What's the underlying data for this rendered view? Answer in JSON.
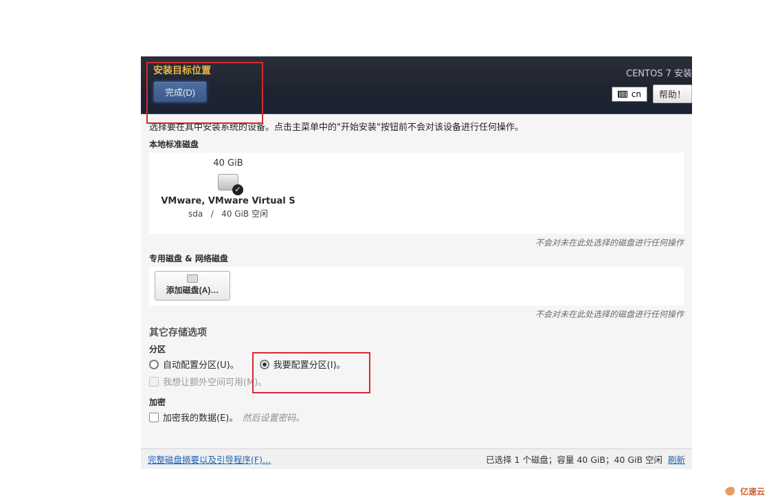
{
  "header": {
    "page_title": "安装目标位置",
    "done_button": "完成(D)",
    "os_name": "CENTOS 7 安装",
    "lang_indicator": "cn",
    "help_button": "帮助！"
  },
  "instruction": "选择要在其中安装系统的设备。点击主菜单中的\"开始安装\"按钮前不会对该设备进行任何操作。",
  "sections": {
    "local_disks": "本地标准磁盘",
    "special_disks": "专用磁盘 & 网络磁盘",
    "other_storage": "其它存储选项"
  },
  "disk": {
    "size": "40 GiB",
    "name": "VMware, VMware Virtual S",
    "dev": "sda",
    "sep": "/",
    "free": "40 GiB 空闲",
    "selected": true
  },
  "hints": {
    "not_affected": "不会对未在此处选择的磁盘进行任何操作"
  },
  "add_disk_button": "添加磁盘(A)…",
  "partition": {
    "heading": "分区",
    "auto": "自动配置分区(U)。",
    "manual": "我要配置分区(I)。",
    "extra_space": "我想让额外空间可用(M)。",
    "selected": "manual"
  },
  "encrypt": {
    "heading": "加密",
    "label": "加密我的数据(E)。",
    "hint": "然后设置密码。"
  },
  "bottom": {
    "summary_link": "完整磁盘摘要以及引导程序(F)…",
    "status": "已选择 1 个磁盘；容量 40 GiB；40 GiB 空闲",
    "refresh": "刷新"
  },
  "watermark": "亿速云"
}
